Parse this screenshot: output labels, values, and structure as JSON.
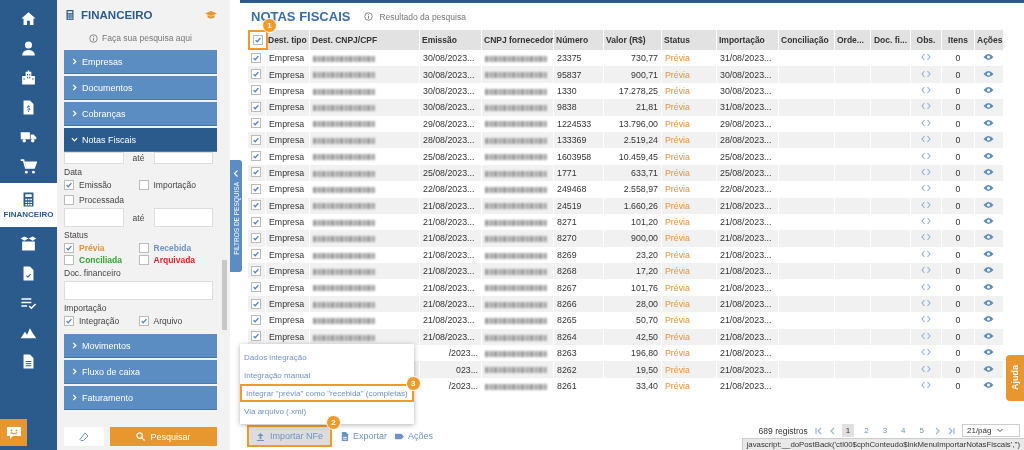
{
  "rail": {
    "items": [
      {
        "kind": "home",
        "selected": false
      },
      {
        "kind": "person",
        "selected": false
      },
      {
        "kind": "building",
        "selected": false
      },
      {
        "kind": "invoice",
        "selected": false
      },
      {
        "kind": "truck",
        "selected": false
      },
      {
        "kind": "cart",
        "selected": false
      },
      {
        "kind": "calculator",
        "label": "FINANCEIRO",
        "selected": true
      },
      {
        "kind": "boxes",
        "selected": false
      },
      {
        "kind": "doccheck",
        "selected": false
      },
      {
        "kind": "checklist",
        "selected": false
      },
      {
        "kind": "chart",
        "selected": false
      },
      {
        "kind": "document",
        "selected": false
      }
    ]
  },
  "filter_panel": {
    "title": "FINANCEIRO",
    "hint": "Faça sua pesquisa aqui",
    "sections": [
      {
        "label": "Empresas",
        "expanded": false
      },
      {
        "label": "Documentos",
        "expanded": false
      },
      {
        "label": "Cobranças",
        "expanded": false
      },
      {
        "label": "Notas Fiscais",
        "expanded": true
      },
      {
        "label": "Movimentos",
        "expanded": false
      },
      {
        "label": "Fluxo de caixa",
        "expanded": false
      },
      {
        "label": "Faturamento",
        "expanded": false
      }
    ],
    "filters": {
      "range_separator": "até",
      "data_label": "Data",
      "data_options": [
        {
          "label": "Emissão",
          "checked": true
        },
        {
          "label": "Importação",
          "checked": false
        },
        {
          "label": "Processada",
          "checked": false
        }
      ],
      "date_separator": "até",
      "status_label": "Status",
      "status_options": [
        {
          "label": "Prévia",
          "checked": true,
          "color": "#e8923a"
        },
        {
          "label": "Recebida",
          "checked": false,
          "color": "#6b93c4"
        },
        {
          "label": "Conciliada",
          "checked": false,
          "color": "#2ea82e"
        },
        {
          "label": "Arquivada",
          "checked": false,
          "color": "#e02424"
        }
      ],
      "doc_label": "Doc. financeiro",
      "import_label": "Importação",
      "import_options": [
        {
          "label": "Integração",
          "checked": true
        },
        {
          "label": "Arquivo",
          "checked": true
        }
      ]
    },
    "search_button": "Pesquisar"
  },
  "side_tab": "FILTROS DE PESQUISA",
  "title": "NOTAS FISCAIS",
  "subtitle": "Resultado da pesquisa",
  "table": {
    "select_all": {
      "checked": true,
      "callout": "1"
    },
    "columns": [
      "Dest. tipo",
      "Dest. CNPJ/CPF",
      "Emissão",
      "CNPJ fornecedor",
      "Número",
      "Valor (R$)",
      "Status",
      "Importação",
      "Conciliação",
      "Orde...",
      "Doc. fi...",
      "Obs.",
      "Itens",
      "Ações"
    ],
    "rows": [
      {
        "checked": true,
        "dest_tipo": "Empresa",
        "emissao": "30/08/2023...",
        "numero": "23375",
        "valor": "730,77",
        "status": "Prévia",
        "importacao": "31/08/2023...",
        "itens": "0"
      },
      {
        "checked": true,
        "dest_tipo": "Empresa",
        "emissao": "30/08/2023...",
        "numero": "95837",
        "valor": "900,71",
        "status": "Prévia",
        "importacao": "30/08/2023...",
        "itens": "0"
      },
      {
        "checked": true,
        "dest_tipo": "Empresa",
        "emissao": "30/08/2023...",
        "numero": "1330",
        "valor": "17.278,25",
        "status": "Prévia",
        "importacao": "30/08/2023...",
        "itens": "0"
      },
      {
        "checked": true,
        "dest_tipo": "Empresa",
        "emissao": "30/08/2023...",
        "numero": "9838",
        "valor": "21,81",
        "status": "Prévia",
        "importacao": "31/08/2023...",
        "itens": "0"
      },
      {
        "checked": true,
        "dest_tipo": "Empresa",
        "emissao": "29/08/2023...",
        "numero": "1224533",
        "valor": "13.796,00",
        "status": "Prévia",
        "importacao": "29/08/2023...",
        "itens": "0"
      },
      {
        "checked": true,
        "dest_tipo": "Empresa",
        "emissao": "28/08/2023...",
        "numero": "133369",
        "valor": "2.519,24",
        "status": "Prévia",
        "importacao": "28/08/2023...",
        "itens": "0"
      },
      {
        "checked": true,
        "dest_tipo": "Empresa",
        "emissao": "25/08/2023...",
        "numero": "1603958",
        "valor": "10.459,45",
        "status": "Prévia",
        "importacao": "25/08/2023...",
        "itens": "0"
      },
      {
        "checked": true,
        "dest_tipo": "Empresa",
        "emissao": "25/08/2023...",
        "numero": "1771",
        "valor": "633,71",
        "status": "Prévia",
        "importacao": "25/08/2023...",
        "itens": "0"
      },
      {
        "checked": true,
        "dest_tipo": "Empresa",
        "emissao": "22/08/2023...",
        "numero": "249468",
        "valor": "2.558,97",
        "status": "Prévia",
        "importacao": "22/08/2023...",
        "itens": "0"
      },
      {
        "checked": true,
        "dest_tipo": "Empresa",
        "emissao": "21/08/2023...",
        "numero": "24519",
        "valor": "1.660,26",
        "status": "Prévia",
        "importacao": "21/08/2023...",
        "itens": "0"
      },
      {
        "checked": true,
        "dest_tipo": "Empresa",
        "emissao": "21/08/2023...",
        "numero": "8271",
        "valor": "101,20",
        "status": "Prévia",
        "importacao": "21/08/2023...",
        "itens": "0"
      },
      {
        "checked": true,
        "dest_tipo": "Empresa",
        "emissao": "21/08/2023...",
        "numero": "8270",
        "valor": "900,00",
        "status": "Prévia",
        "importacao": "21/08/2023...",
        "itens": "0"
      },
      {
        "checked": true,
        "dest_tipo": "Empresa",
        "emissao": "21/08/2023...",
        "numero": "8269",
        "valor": "23,20",
        "status": "Prévia",
        "importacao": "21/08/2023...",
        "itens": "0"
      },
      {
        "checked": true,
        "dest_tipo": "Empresa",
        "emissao": "21/08/2023...",
        "numero": "8268",
        "valor": "17,20",
        "status": "Prévia",
        "importacao": "21/08/2023...",
        "itens": "0"
      },
      {
        "checked": true,
        "dest_tipo": "Empresa",
        "emissao": "21/08/2023...",
        "numero": "8267",
        "valor": "101,76",
        "status": "Prévia",
        "importacao": "21/08/2023...",
        "itens": "0"
      },
      {
        "checked": true,
        "dest_tipo": "Empresa",
        "emissao": "21/08/2023...",
        "numero": "8266",
        "valor": "28,00",
        "status": "Prévia",
        "importacao": "21/08/2023...",
        "itens": "0"
      },
      {
        "checked": true,
        "dest_tipo": "Empresa",
        "emissao": "21/08/2023...",
        "numero": "8265",
        "valor": "50,70",
        "status": "Prévia",
        "importacao": "21/08/2023...",
        "itens": "0"
      },
      {
        "checked": true,
        "dest_tipo": "Empresa",
        "emissao": "21/08/2023...",
        "numero": "8264",
        "valor": "42,50",
        "status": "Prévia",
        "importacao": "21/08/2023...",
        "itens": "0"
      },
      {
        "emissao": "/2023...",
        "numero": "8263",
        "valor": "196,80",
        "status": "Prévia",
        "importacao": "21/08/2023...",
        "itens": "0"
      },
      {
        "emissao": "023...",
        "numero": "8262",
        "valor": "19,50",
        "status": "Prévia",
        "importacao": "21/08/2023...",
        "itens": "0"
      },
      {
        "emissao": "/2023...",
        "numero": "8261",
        "valor": "33,40",
        "status": "Prévia",
        "importacao": "21/08/2023...",
        "itens": "0"
      }
    ]
  },
  "import_menu": [
    {
      "label": "Dados integração"
    },
    {
      "label": "Integração manual"
    },
    {
      "label": "Integrar \"prévia\" como \"recebida\" (completas)",
      "callout": "3"
    },
    {
      "label": "Via arquivo (.xml)"
    }
  ],
  "toolbar": [
    {
      "kind": "import",
      "label": "Importar NFe",
      "callout": "2"
    },
    {
      "kind": "export",
      "label": "Exportar"
    },
    {
      "kind": "actions",
      "label": "Ações"
    }
  ],
  "pagination": {
    "total": "689 registros",
    "pages": [
      {
        "label": "1",
        "selected": true
      },
      {
        "label": "2",
        "selected": false
      },
      {
        "label": "3",
        "selected": false
      },
      {
        "label": "4",
        "selected": false
      },
      {
        "label": "5",
        "selected": false
      }
    ],
    "per_page": "21/pág"
  },
  "help_tab": "Ajuda",
  "browser_status": "javascript:__doPostBack('ctl00$cphConteudo$lnkMenuImportarNotasFiscais','')"
}
